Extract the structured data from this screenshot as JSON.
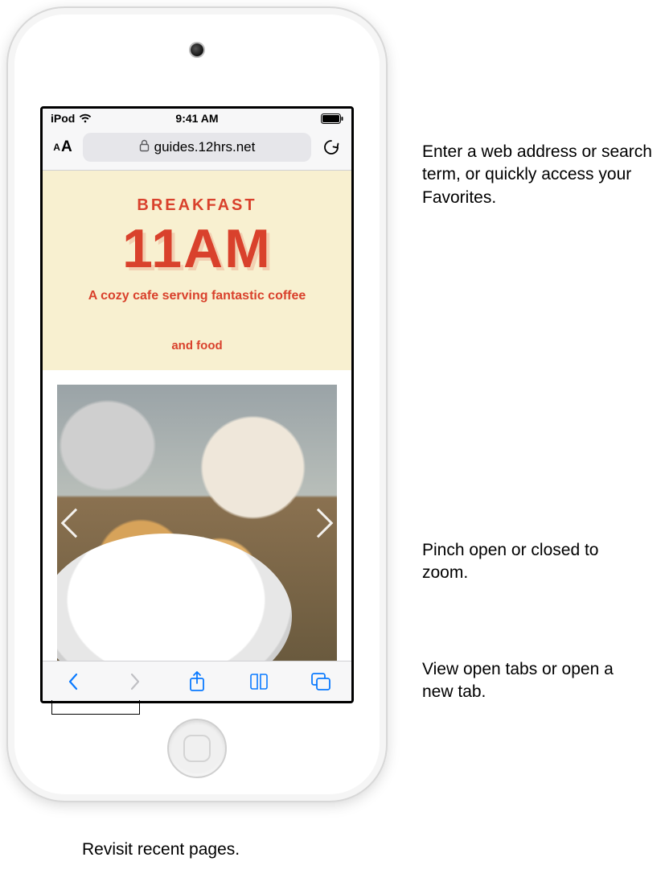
{
  "status": {
    "carrier": "iPod",
    "time": "9:41 AM"
  },
  "address": {
    "url": "guides.12hrs.net"
  },
  "page": {
    "label": "BREAKFAST",
    "time": "11AM",
    "sub1": "A cozy cafe serving fantastic coffee",
    "sub2": "and food"
  },
  "callouts": {
    "address": "Enter a web address or search term, or quickly access your Favorites.",
    "zoom": "Pinch open or closed to zoom.",
    "tabs": "View open tabs or open a new tab.",
    "history": "Revisit recent pages."
  }
}
